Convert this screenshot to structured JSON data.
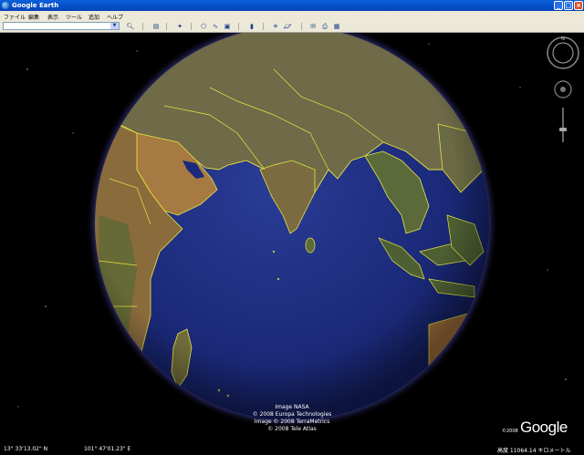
{
  "window": {
    "title": "Google Earth"
  },
  "menu": [
    "ファイル",
    "編集",
    "表示",
    "ツール",
    "追加",
    "ヘルプ"
  ],
  "search": {
    "value": "",
    "placeholder": ""
  },
  "toolbar_icons": [
    "search-go-icon",
    "sidebar-icon",
    "placemark-icon",
    "polygon-icon",
    "path-icon",
    "image-overlay-icon",
    "record-tour-icon",
    "sunlight-icon",
    "planets-icon",
    "email-icon",
    "print-icon",
    "maps-icon"
  ],
  "attribution": [
    "Image NASA",
    "© 2008 Europa Technologies",
    "Image © 2008 TerraMetrics",
    "© 2008 Tele Atlas"
  ],
  "logo": {
    "text": "Google",
    "copyright": "©2008"
  },
  "status": {
    "latitude": "13° 33'13.02\" N",
    "longitude": "101° 47'01.23\" E",
    "altitude": "高度 11064.14 キロメートル"
  },
  "nav_labels": {
    "north": "N"
  },
  "colors": {
    "ocean": "#1b2a7a",
    "border": "#e8e640",
    "atmosphere": "#6a6aff",
    "titlebar": "#0a5fd8"
  }
}
